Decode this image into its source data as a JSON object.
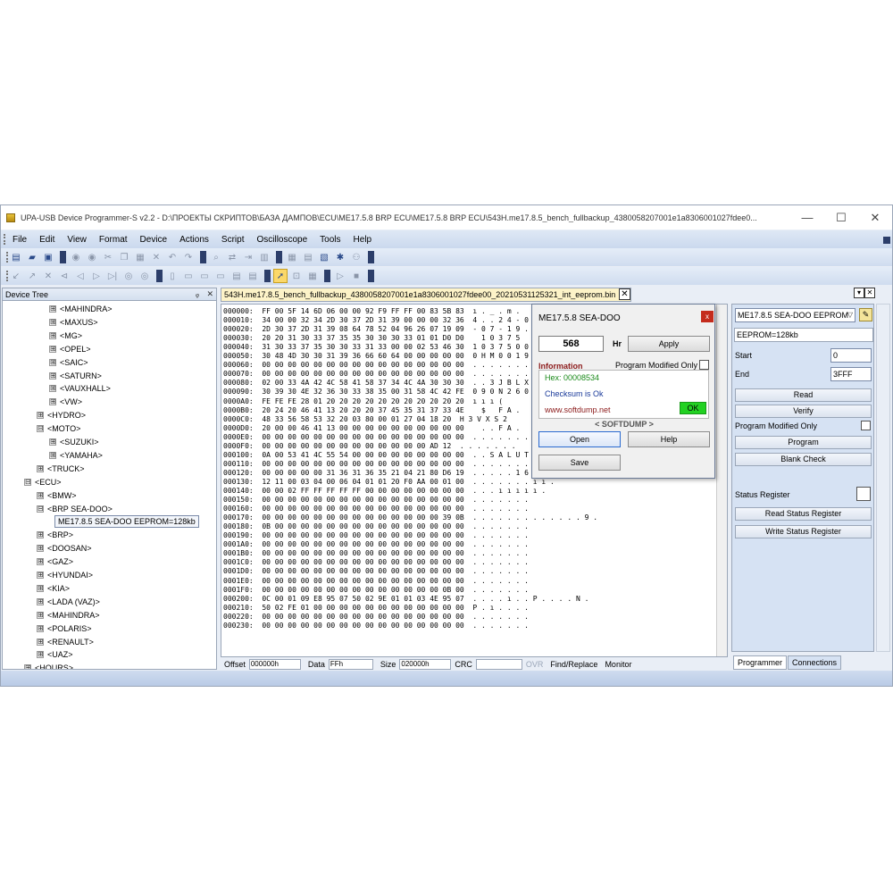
{
  "window": {
    "title": "UPA-USB Device Programmer-S v2.2 - D:\\ПРОЕКТЫ СКРИПТОВ\\БАЗА ДАМПОВ\\ECU\\ME17.5.8 BRP ECU\\ME17.5.8 BRP ECU\\543H.me17.8.5_bench_fullbackup_4380058207001e1a8306001027fdee0...",
    "minimize": "—",
    "maximize": "☐",
    "close": "✕"
  },
  "menu": [
    "File",
    "Edit",
    "View",
    "Format",
    "Device",
    "Actions",
    "Script",
    "Oscilloscope",
    "Tools",
    "Help"
  ],
  "device_tree": {
    "title": "Device Tree",
    "pin": "ᵩ",
    "close": "✕",
    "nodes": [
      {
        "label": "<MAHINDRA>",
        "exp": "⊞",
        "level": 3
      },
      {
        "label": "<MAXUS>",
        "exp": "⊞",
        "level": 3
      },
      {
        "label": "<MG>",
        "exp": "⊞",
        "level": 3
      },
      {
        "label": "<OPEL>",
        "exp": "⊞",
        "level": 3
      },
      {
        "label": "<SAIC>",
        "exp": "⊞",
        "level": 3
      },
      {
        "label": "<SATURN>",
        "exp": "⊞",
        "level": 3
      },
      {
        "label": "<VAUXHALL>",
        "exp": "⊞",
        "level": 3
      },
      {
        "label": "<VW>",
        "exp": "⊞",
        "level": 3
      },
      {
        "label": "<HYDRO>",
        "exp": "⊞",
        "level": 2
      },
      {
        "label": "<MOTO>",
        "exp": "⊟",
        "level": 2
      },
      {
        "label": "<SUZUKI>",
        "exp": "⊞",
        "level": 3
      },
      {
        "label": "<YAMAHA>",
        "exp": "⊞",
        "level": 3
      },
      {
        "label": "<TRUCK>",
        "exp": "⊞",
        "level": 2
      },
      {
        "label": "<ECU>",
        "exp": "⊟",
        "level": 1
      },
      {
        "label": "<BMW>",
        "exp": "⊞",
        "level": 2
      },
      {
        "label": "<BRP SEA-DOO>",
        "exp": "⊟",
        "level": 2
      },
      {
        "label": "ME17.8.5 SEA-DOO EEPROM=128kb",
        "exp": "",
        "level": 4,
        "selected": true
      },
      {
        "label": "<BRP>",
        "exp": "⊞",
        "level": 2
      },
      {
        "label": "<DOOSAN>",
        "exp": "⊞",
        "level": 2
      },
      {
        "label": "<GAZ>",
        "exp": "⊞",
        "level": 2
      },
      {
        "label": "<HYUNDAI>",
        "exp": "⊞",
        "level": 2
      },
      {
        "label": "<KIA>",
        "exp": "⊞",
        "level": 2
      },
      {
        "label": "<LADA (VAZ)>",
        "exp": "⊞",
        "level": 2
      },
      {
        "label": "<MAHINDRA>",
        "exp": "⊞",
        "level": 2
      },
      {
        "label": "<POLARIS>",
        "exp": "⊞",
        "level": 2
      },
      {
        "label": "<RENAULT>",
        "exp": "⊞",
        "level": 2
      },
      {
        "label": "<UAZ>",
        "exp": "⊞",
        "level": 2
      },
      {
        "label": "<HOURS>",
        "exp": "⊞",
        "level": 1
      }
    ]
  },
  "hex_editor": {
    "tab_title": "543H.me17.8.5_bench_fullbackup_4380058207001e1a8306001027fdee00_20210531125321_int_eeprom.bin",
    "tab_close": "✕",
    "rows": [
      "000000:  FF 00 5F 14 6D 06 00 00 92 F9 FF FF 00 83 5B 83  ı . _ . m .",
      "000010:  34 00 00 32 34 2D 30 37 2D 31 39 00 00 00 32 36  4 . . 2 4 - 0",
      "000020:  2D 30 37 2D 31 39 08 64 78 52 04 96 26 07 19 09  - 0 7 - 1 9 .",
      "000030:  20 20 31 30 33 37 35 35 30 30 30 33 01 01 D0 D0    1 0 3 7 5",
      "000040:  31 30 33 37 35 30 30 33 31 33 00 00 02 53 46 30  1 0 3 7 5 0 0",
      "000050:  30 48 4D 30 30 31 39 36 66 60 64 00 00 00 00 00  0 H M 0 0 1 9",
      "000060:  00 00 00 00 00 00 00 00 00 00 00 00 00 00 00 00  . . . . . . .",
      "000070:  00 00 00 00 00 00 00 00 00 00 00 00 00 00 00 00  . . . . . . .",
      "000080:  02 00 33 4A 42 4C 58 41 58 37 34 4C 4A 30 30 30  . . 3 J B L X",
      "000090:  30 39 30 4E 32 36 30 33 38 35 00 31 58 4C 42 FE  0 9 0 N 2 6 0",
      "0000A0:  FE FE FE 28 01 20 20 20 20 20 20 20 20 20 20 20  ı ı ı (",
      "0000B0:  20 24 20 46 41 13 20 20 20 37 45 35 31 37 33 4E    $   F A .",
      "0000C0:  48 33 56 58 53 32 20 03 80 00 01 27 04 18 20  H 3 V X S 2",
      "0000D0:  20 00 00 46 41 13 00 00 00 00 00 00 00 00 00 00    . . F A .",
      "0000E0:  00 00 00 00 00 00 00 00 00 00 00 00 00 00 00 00  . . . . . . .",
      "0000F0:  00 00 00 00 00 00 00 00 00 00 00 00 00 AD 12  . . . . . . .",
      "000100:  0A 00 53 41 4C 55 54 00 00 00 00 00 00 00 00 00  . . S A L U T",
      "000110:  00 00 00 00 00 00 00 00 00 00 00 00 00 00 00 00  . . . . . . .",
      "000120:  00 00 00 00 00 31 36 31 36 35 21 04 21 80 D6 19  . . . . . 1 6 1 6 5 ! . !",
      "000130:  12 11 00 03 04 00 06 04 01 01 20 F0 AA 00 01 00  . . . . . . . ı ı .",
      "000140:  00 00 02 FF FF FF FF FF 00 00 00 00 00 00 00 00  . . . ı ı ı ı ı .",
      "000150:  00 00 00 00 00 00 00 00 00 00 00 00 00 00 00 00  . . . . . . .",
      "000160:  00 00 00 00 00 00 00 00 00 00 00 00 00 00 00 00  . . . . . . .",
      "000170:  00 00 00 00 00 00 00 00 00 00 00 00 00 00 39 0B  . . . . . . . . . . . . . 9 .",
      "000180:  0B 00 00 00 00 00 00 00 00 00 00 00 00 00 00 00  . . . . . . .",
      "000190:  00 00 00 00 00 00 00 00 00 00 00 00 00 00 00 00  . . . . . . .",
      "0001A0:  00 00 00 00 00 00 00 00 00 00 00 00 00 00 00 00  . . . . . . .",
      "0001B0:  00 00 00 00 00 00 00 00 00 00 00 00 00 00 00 00  . . . . . . .",
      "0001C0:  00 00 00 00 00 00 00 00 00 00 00 00 00 00 00 00  . . . . . . .",
      "0001D0:  00 00 00 00 00 00 00 00 00 00 00 00 00 00 00 00  . . . . . . .",
      "0001E0:  00 00 00 00 00 00 00 00 00 00 00 00 00 00 00 00  . . . . . . .",
      "0001F0:  00 00 00 00 00 00 00 00 00 00 00 00 00 00 0B 00  . . . . . . .",
      "000200:  0C 00 01 09 E8 95 07 50 02 9E 01 01 03 4E 95 07  . . . . ı . . P . . . . N .",
      "000210:  50 02 FE 01 00 00 00 00 00 00 00 00 00 00 00 00  P . ı . . . .",
      "000220:  00 00 00 00 00 00 00 00 00 00 00 00 00 00 00 00  . . . . . . .",
      "000230:  00 00 00 00 00 00 00 00 00 00 00 00 00 00 00 00  . . . . . . ."
    ]
  },
  "statusbar": {
    "offset_label": "Offset",
    "offset_value": "000000h",
    "data_label": "Data",
    "data_value": "FFh",
    "size_label": "Size",
    "size_value": "020000h",
    "crc_label": "CRC",
    "crc_value": "",
    "ovr_label": "OVR",
    "find_replace": "Find/Replace",
    "monitor": "Monitor"
  },
  "dialog": {
    "title": "ME17.5.8 SEA-DOO",
    "close": "x",
    "hours_value": "568",
    "hours_unit": "Hr",
    "apply": "Apply",
    "information_label": "Information",
    "program_modified_only": "Program Modified Only",
    "hex_line": "Hex: 00008534",
    "checksum_line": "Checksum is Ok",
    "url": "www.softdump.net",
    "ok_badge": "OK",
    "brand": "< SOFTDUMP >",
    "open": "Open",
    "help": "Help",
    "save": "Save",
    "colors": {
      "hex_line": "#1a8a1a",
      "checksum_line": "#1a3a9a",
      "url": "#8b1a1a",
      "ok_badge": "#22d122"
    }
  },
  "right_panel": {
    "device_select": "ME17.8.5 SEA-DOO EEPROM",
    "eeprom_info": "EEPROM=128kb",
    "start_label": "Start",
    "start_value": "0",
    "end_label": "End",
    "end_value": "3FFF",
    "read": "Read",
    "verify": "Verify",
    "program_modified_only": "Program Modified Only",
    "program": "Program",
    "blank_check": "Blank Check",
    "status_register": "Status Register",
    "read_status_register": "Read Status Register",
    "write_status_register": "Write Status Register",
    "tabs": [
      "Programmer",
      "Connections"
    ],
    "active_tab": "Programmer"
  },
  "toolbar_icons": {
    "row1": [
      "new-icon",
      "open-icon",
      "save-icon",
      "refresh-icon",
      "reload-icon",
      "cut-icon",
      "copy-icon",
      "paste-icon",
      "delete-icon",
      "undo-icon",
      "redo-icon",
      "find-icon",
      "replace-icon",
      "goto-icon",
      "chart-icon",
      "table-icon",
      "text-icon",
      "script-icon",
      "bug-icon",
      "link-icon"
    ],
    "row2": [
      "prev-icon",
      "play-icon",
      "stop-icon",
      "back-icon",
      "fwd-icon",
      "first-icon",
      "last-icon",
      "split-icon",
      "merge-icon",
      "list-icon",
      "cursor-icon",
      "zoom-icon",
      "cycle-icon",
      "play2-icon",
      "stop2-icon"
    ]
  }
}
